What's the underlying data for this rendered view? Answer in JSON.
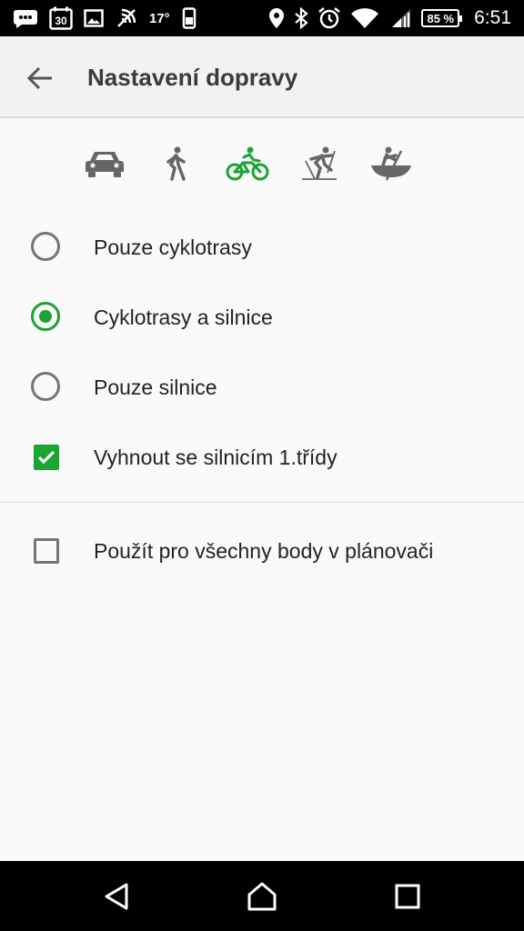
{
  "status_bar": {
    "calendar_day": "30",
    "temperature": "17°",
    "battery": "85 %",
    "time": "6:51",
    "icons": [
      "messages-icon",
      "calendar-icon",
      "image-icon",
      "nfc-icon",
      "phone-screen-icon",
      "location-icon",
      "bluetooth-icon",
      "alarm-icon",
      "wifi-icon",
      "signal-icon",
      "battery-icon"
    ]
  },
  "app_bar": {
    "title": "Nastavení dopravy",
    "back_icon": "arrow-back-icon"
  },
  "transport_modes": [
    {
      "name": "car-icon",
      "selected": false
    },
    {
      "name": "walk-icon",
      "selected": false
    },
    {
      "name": "bike-icon",
      "selected": true
    },
    {
      "name": "ski-icon",
      "selected": false
    },
    {
      "name": "canoe-icon",
      "selected": false
    }
  ],
  "route_options": {
    "radio_1": {
      "label": "Pouze cyklotrasy",
      "checked": false
    },
    "radio_2": {
      "label": "Cyklotrasy a silnice",
      "checked": true
    },
    "radio_3": {
      "label": "Pouze silnice",
      "checked": false
    },
    "check_1": {
      "label": "Vyhnout se silnicím 1.třídy",
      "checked": true
    }
  },
  "planner_option": {
    "label": "Použít pro všechny body v plánovači",
    "checked": false
  },
  "colors": {
    "accent": "#1aa432",
    "inactive_icon": "#666666",
    "app_bar_bg": "#f2f2f2",
    "page_bg": "#fafafa"
  },
  "nav_bar": {
    "icons": [
      "back-triangle-icon",
      "home-icon",
      "recents-icon"
    ]
  }
}
